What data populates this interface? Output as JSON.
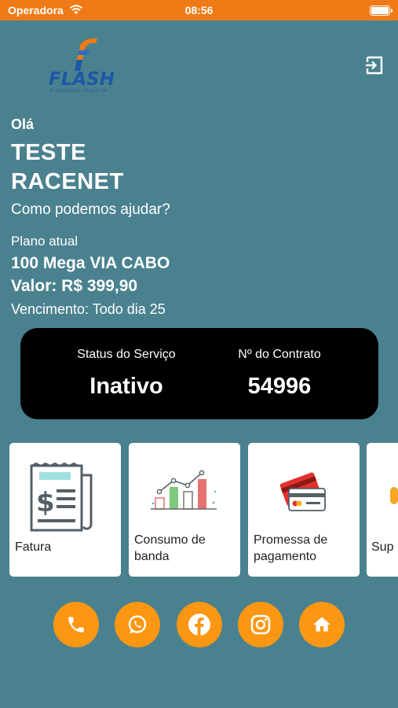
{
  "status_bar": {
    "carrier": "Operadora",
    "time": "08:56"
  },
  "logo": {
    "text": "FLASH",
    "tagline": "A CONEXÃO PERFEITA"
  },
  "greeting": "Olá",
  "user": {
    "name_line1": "TESTE",
    "name_line2": "RACENET"
  },
  "help_text": "Como podemos ajudar?",
  "plan": {
    "label": "Plano atual",
    "name": "100 Mega VIA CABO",
    "value": "Valor: R$ 399,90",
    "due": "Vencimento: Todo dia 25"
  },
  "service_card": {
    "status_label": "Status do Serviço",
    "status_value": "Inativo",
    "contract_label": "Nº do Contrato",
    "contract_value": "54996"
  },
  "tiles": [
    {
      "label": "Fatura",
      "icon": "invoice-icon"
    },
    {
      "label_line1": "Consumo de",
      "label_line2": "banda",
      "icon": "bandwidth-chart-icon"
    },
    {
      "label_line1": "Promessa de",
      "label_line2": "pagamento",
      "icon": "credit-card-icon"
    },
    {
      "label": "Sup",
      "icon": "support-icon"
    }
  ],
  "contact_buttons": [
    {
      "icon": "phone-icon"
    },
    {
      "icon": "whatsapp-icon"
    },
    {
      "icon": "facebook-icon"
    },
    {
      "icon": "instagram-icon"
    },
    {
      "icon": "home-icon"
    }
  ],
  "colors": {
    "background": "#4a818f",
    "status_bar": "#f07b16",
    "accent": "#fb9712",
    "logo_blue": "#1e57a6",
    "card": "#000000"
  }
}
